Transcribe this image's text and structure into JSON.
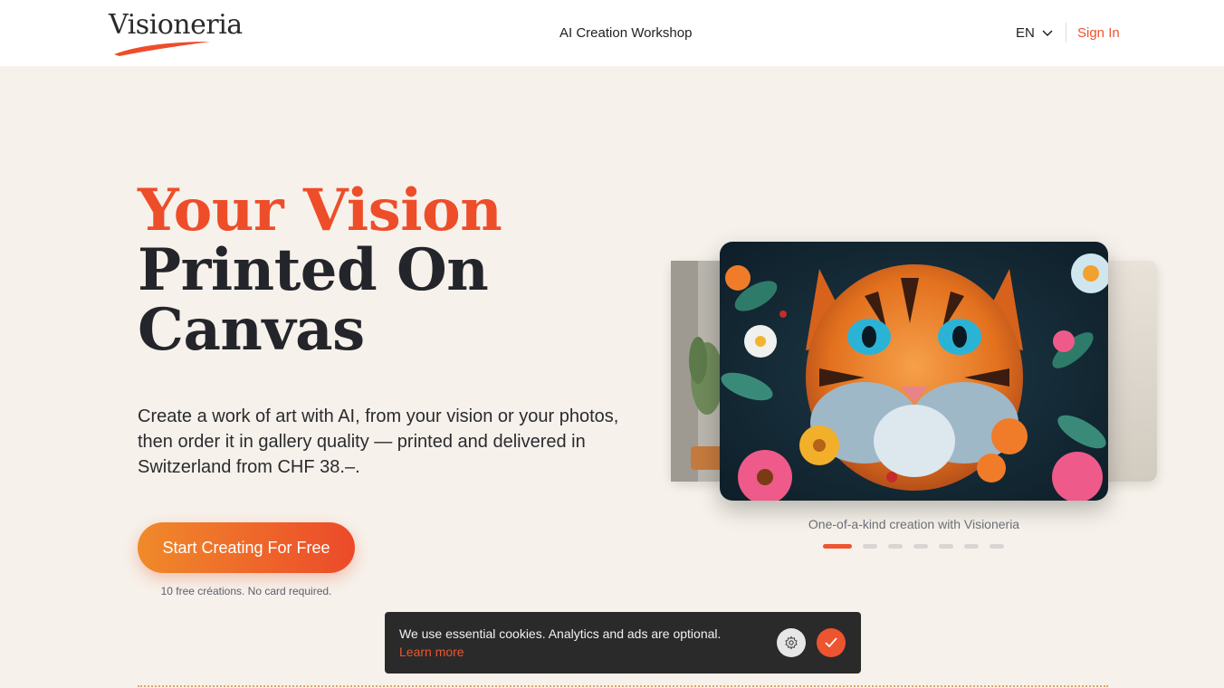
{
  "header": {
    "logo_text": "Visioneria",
    "nav_link": "AI Creation Workshop",
    "language": "EN",
    "sign_in": "Sign In"
  },
  "hero": {
    "headline_accent": "Your Vision",
    "headline_line2": "Printed On",
    "headline_line3": "Canvas",
    "subtitle": "Create a work of art with AI, from your vision or your photos, then order it in gallery quality — printed and delivered in Switzerland from CHF 38.–.",
    "cta_label": "Start Creating For Free",
    "cta_note": "10 free créations. No card required."
  },
  "carousel": {
    "caption": "One-of-a-kind creation with Visioneria",
    "slide_count": 7,
    "active_index": 0
  },
  "cookie_banner": {
    "text": "We use essential cookies. Analytics and ads are optional.",
    "link": "Learn more"
  },
  "icons": {
    "language": "chevron-down-icon",
    "settings": "gear-icon",
    "accept": "check-icon"
  },
  "colors": {
    "accent": "#ee4d2a",
    "background": "#f6f1ea",
    "cookie_bg": "#2a2a2a"
  }
}
